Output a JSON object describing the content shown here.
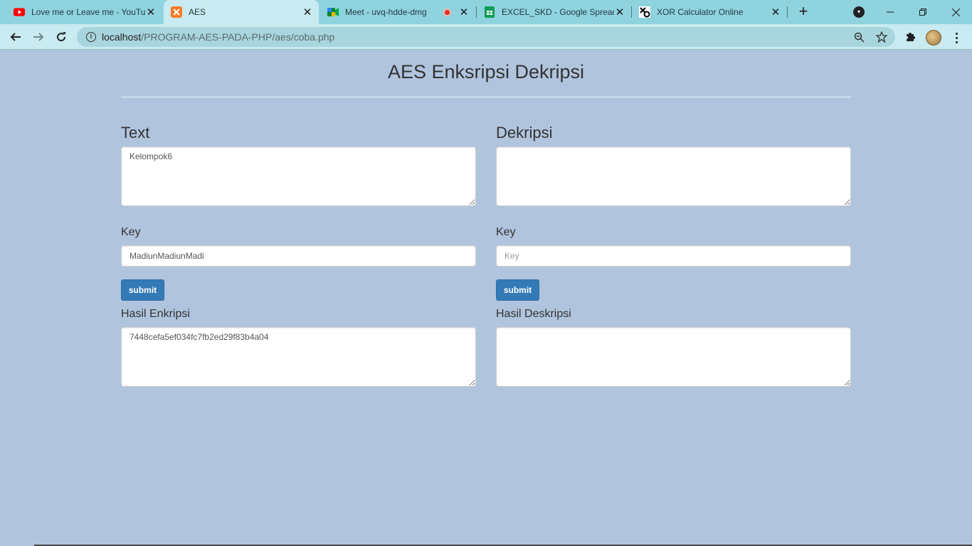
{
  "browser": {
    "tabs": [
      {
        "title": "Love me or Leave me - YouTu",
        "icon": "youtube-icon"
      },
      {
        "title": "AES",
        "icon": "xampp-icon"
      },
      {
        "title": "Meet - uvq-hdde-dmg",
        "icon": "google-meet-icon"
      },
      {
        "title": "EXCEL_SKD - Google Spreads",
        "icon": "google-sheets-icon"
      },
      {
        "title": "XOR Calculator Online",
        "icon": "xor-icon"
      }
    ],
    "close_glyph": "✕",
    "new_tab_glyph": "+",
    "url_host": "localhost",
    "url_path": "/PROGRAM-AES-PADA-PHP/aes/coba.php"
  },
  "page": {
    "title": "AES Enksripsi Dekripsi",
    "left": {
      "heading": "Text",
      "text_value": "Kelompok6",
      "key_label": "Key",
      "key_value": "MadiunMadiunMadi",
      "key_placeholder": "Key",
      "submit_label": "submit",
      "result_label": "Hasil Enkripsi",
      "result_value": "7448cefa5ef034fc7fb2ed29f83b4a04"
    },
    "right": {
      "heading": "Dekripsi",
      "text_value": "",
      "key_label": "Key",
      "key_value": "",
      "key_placeholder": "Key",
      "submit_label": "submit",
      "result_label": "Hasil Deskripsi",
      "result_value": ""
    }
  },
  "colors": {
    "page_background": "#b0c4de",
    "button": "#337ab7",
    "tabstrip": "#8fd3df",
    "toolbar": "#c8eaf0"
  }
}
